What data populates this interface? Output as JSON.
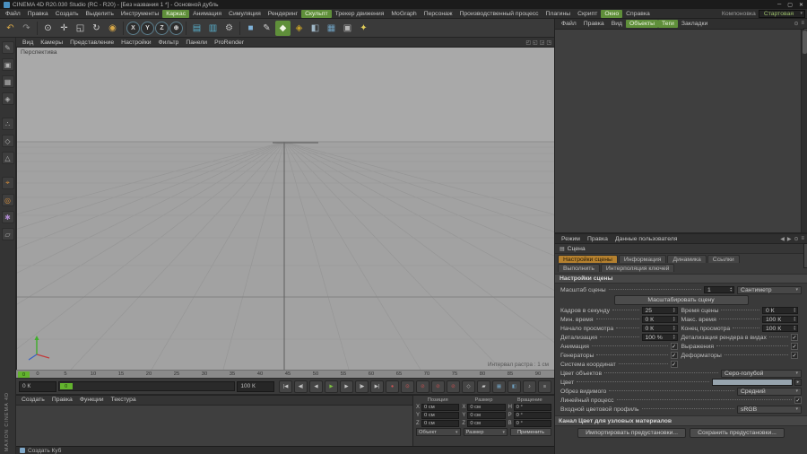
{
  "ui": {
    "dropdown_arrow": "▾",
    "check": "✓",
    "spin_up": "▲",
    "spin_down": "▼",
    "expand": "▸",
    "win_min": "─",
    "win_max": "▢",
    "win_close": "✕"
  },
  "colors": {
    "accent_green": "#5f8f3a",
    "active_tab_orange": "#b5812f",
    "viewport_gray": "#a6a6a6",
    "play_green": "#7dc142",
    "timeline_marker_green": "#63b32e",
    "object_color_swatch": "#97a4ae"
  },
  "titlebar": {
    "title": "CINEMA 4D R20.030 Studio (RC - R20) - [Без названия 1 *] - Основной дубль"
  },
  "menubar": {
    "items": [
      {
        "label": "Файл"
      },
      {
        "label": "Правка"
      },
      {
        "label": "Создать"
      },
      {
        "label": "Выделить"
      },
      {
        "label": "Инструменты"
      },
      {
        "label": "Каркас",
        "highlight": true
      },
      {
        "label": "Анимация"
      },
      {
        "label": "Симуляция"
      },
      {
        "label": "Рендеринг"
      },
      {
        "label": "Скульпт",
        "highlight": true
      },
      {
        "label": "Трекер движения"
      },
      {
        "label": "MoGraph"
      },
      {
        "label": "Персонаж"
      },
      {
        "label": "Производственный процесс"
      },
      {
        "label": "Плагины"
      },
      {
        "label": "Скрипт"
      },
      {
        "label": "Окно",
        "highlight": true
      },
      {
        "label": "Справка"
      }
    ],
    "layout_label": "Компоновка",
    "layout_value": "Стартовая"
  },
  "toolbar": {
    "icons": [
      {
        "name": "undo-icon",
        "glyph": "↶",
        "color": "#d8a848"
      },
      {
        "name": "redo-icon",
        "glyph": "↷",
        "color": "#8f8f8f"
      },
      {
        "sep": true
      },
      {
        "name": "live-selection-icon",
        "glyph": "⊙",
        "color": "#d8d8d8"
      },
      {
        "name": "move-icon",
        "glyph": "✛",
        "color": "#cfcfcf"
      },
      {
        "name": "scale-icon",
        "glyph": "◱",
        "color": "#cfcfcf"
      },
      {
        "name": "rotate-icon",
        "glyph": "↻",
        "color": "#cfcfcf"
      },
      {
        "name": "last-tool-icon",
        "glyph": "◉",
        "color": "#d8a848"
      },
      {
        "sep": true
      },
      {
        "name": "x-axis-lock-button",
        "glyph": "X",
        "circle": true,
        "color": "#d8d8d8"
      },
      {
        "name": "y-axis-lock-button",
        "glyph": "Y",
        "circle": true,
        "color": "#d8d8d8"
      },
      {
        "name": "z-axis-lock-button",
        "glyph": "Z",
        "circle": true,
        "color": "#d8d8d8"
      },
      {
        "name": "coordinate-system-button",
        "glyph": "⊕",
        "circle": true,
        "color": "#d8d8d8"
      },
      {
        "sep": true
      },
      {
        "name": "render-view-icon",
        "glyph": "▤",
        "color": "#58aecb"
      },
      {
        "name": "render-picture-viewer-icon",
        "glyph": "▥",
        "color": "#58aecb"
      },
      {
        "name": "render-settings-icon",
        "glyph": "⚙",
        "color": "#b8b8b8"
      },
      {
        "sep": true
      },
      {
        "name": "add-primitive-icon",
        "glyph": "■",
        "color": "#7fb2d9"
      },
      {
        "name": "add-spline-icon",
        "glyph": "✎",
        "color": "#cfcfcf"
      },
      {
        "name": "add-generator-icon",
        "glyph": "◆",
        "active": true,
        "color": "#eaf2da"
      },
      {
        "name": "add-deformer-icon",
        "glyph": "◈",
        "color": "#c9a227"
      },
      {
        "name": "environment-icon",
        "glyph": "◧",
        "color": "#9fb7c7"
      },
      {
        "name": "mograph-grid-icon",
        "glyph": "▦",
        "color": "#6fa0c0"
      },
      {
        "name": "camera-icon",
        "glyph": "▣",
        "color": "#b5b5b5"
      },
      {
        "name": "light-icon",
        "glyph": "✦",
        "color": "#e3cf5a"
      }
    ]
  },
  "side_toolbar": {
    "icons": [
      {
        "name": "make-editable-icon",
        "glyph": "✎",
        "color": "#b5b5b5"
      },
      {
        "name": "model-mode-icon",
        "glyph": "▣",
        "color": "#b5b5b5"
      },
      {
        "name": "texture-mode-icon",
        "glyph": "▦",
        "color": "#b5b5b5"
      },
      {
        "name": "workplane-mode-icon",
        "glyph": "◈",
        "color": "#b5b5b5"
      },
      {
        "gap": true
      },
      {
        "name": "points-mode-icon",
        "glyph": "∴",
        "color": "#b5b5b5"
      },
      {
        "name": "edges-mode-icon",
        "glyph": "◇",
        "color": "#b5b5b5"
      },
      {
        "name": "polygons-mode-icon",
        "glyph": "△",
        "color": "#b5b5b5"
      },
      {
        "gap": true
      },
      {
        "name": "enable-axis-icon",
        "glyph": "⌖",
        "color": "#d08a3a"
      },
      {
        "name": "axis-workplane-icon",
        "glyph": "◎",
        "color": "#d08a3a"
      },
      {
        "name": "snap-icon",
        "glyph": "✱",
        "color": "#b08ad0"
      },
      {
        "name": "lock-workplane-icon",
        "glyph": "▱",
        "color": "#b5b5b5"
      }
    ]
  },
  "viewport": {
    "menu": [
      "Вид",
      "Камеры",
      "Представление",
      "Настройки",
      "Фильтр",
      "Панели",
      "ProRender"
    ],
    "corner_icons": [
      {
        "name": "pan-view-icon",
        "glyph": "◰"
      },
      {
        "name": "zoom-view-icon",
        "glyph": "◱"
      },
      {
        "name": "rotate-view-icon",
        "glyph": "◲"
      },
      {
        "name": "toggle-view-icon",
        "glyph": "◳"
      }
    ],
    "label": "Перспектива",
    "raster": "Интервал растра : 1 см"
  },
  "timeline": {
    "ticks": [
      "0",
      "5",
      "10",
      "15",
      "20",
      "25",
      "30",
      "35",
      "40",
      "45",
      "50",
      "55",
      "60",
      "65",
      "70",
      "75",
      "80",
      "85",
      "90"
    ],
    "marker": "0"
  },
  "transport": {
    "start": "0 К",
    "end": "100 К",
    "slider_value": "0",
    "buttons": [
      {
        "name": "goto-start-button",
        "glyph": "|◀"
      },
      {
        "name": "prev-key-button",
        "glyph": "◀|"
      },
      {
        "name": "prev-frame-button",
        "glyph": "◀"
      },
      {
        "name": "play-button",
        "glyph": "▶",
        "color": "#7dc142"
      },
      {
        "name": "next-frame-button",
        "glyph": "▶"
      },
      {
        "name": "next-key-button",
        "glyph": "|▶"
      },
      {
        "name": "goto-end-button",
        "glyph": "▶|"
      },
      {
        "name": "record-button",
        "glyph": "●",
        "color": "#cc5555"
      },
      {
        "name": "autokey-button",
        "glyph": "⊙",
        "color": "#cc5555"
      },
      {
        "name": "record-position-button",
        "glyph": "⊘",
        "color": "#c05050"
      },
      {
        "name": "record-scale-button",
        "glyph": "⊘",
        "color": "#c05050"
      },
      {
        "name": "record-rotation-button",
        "glyph": "⊘",
        "color": "#c05050"
      },
      {
        "name": "record-parameter-button",
        "glyph": "◇"
      },
      {
        "name": "record-pla-button",
        "glyph": "▰"
      },
      {
        "name": "playback-options-button",
        "glyph": "▦",
        "color": "#6fa0c0"
      },
      {
        "name": "render-preview-button",
        "glyph": "◧",
        "color": "#6fa0c0"
      },
      {
        "name": "sound-button",
        "glyph": "♪"
      },
      {
        "name": "frame-options-button",
        "glyph": "≡"
      }
    ]
  },
  "material_manager": {
    "tabs": [
      "Создать",
      "Правка",
      "Функции",
      "Текстура"
    ],
    "brand": "MAXON CINEMA 4D"
  },
  "coord_manager": {
    "columns": [
      {
        "title": "Позиция",
        "axes": [
          {
            "label": "X",
            "value": "0 см"
          },
          {
            "label": "Y",
            "value": "0 см"
          },
          {
            "label": "Z",
            "value": "0 см"
          }
        ]
      },
      {
        "title": "Размер",
        "axes": [
          {
            "label": "X",
            "value": "0 см"
          },
          {
            "label": "Y",
            "value": "0 см"
          },
          {
            "label": "Z",
            "value": "0 см"
          }
        ]
      },
      {
        "title": "Вращение",
        "axes": [
          {
            "label": "H",
            "value": "0 °"
          },
          {
            "label": "P",
            "value": "0 °"
          },
          {
            "label": "B",
            "value": "0 °"
          }
        ]
      }
    ],
    "mode_dropdown": "Объект",
    "size_dropdown": "Размер",
    "apply_button": "Применить"
  },
  "statusbar": {
    "text": "Создать Куб"
  },
  "object_manager": {
    "menu": [
      {
        "label": "Файл"
      },
      {
        "label": "Правка"
      },
      {
        "label": "Вид"
      },
      {
        "label": "Объекты",
        "highlight": true
      },
      {
        "label": "Теги",
        "highlight": true
      },
      {
        "label": "Закладки"
      }
    ],
    "icons": [
      {
        "name": "search-icon",
        "glyph": "⊙"
      },
      {
        "name": "filter-icon",
        "glyph": "≡"
      }
    ]
  },
  "attributes": {
    "menu": [
      "Режим",
      "Правка",
      "Данные пользователя"
    ],
    "menu_icons": [
      {
        "name": "history-back-icon",
        "glyph": "◀"
      },
      {
        "name": "history-forward-icon",
        "glyph": "▶"
      },
      {
        "name": "lock-icon",
        "glyph": "⊙"
      },
      {
        "name": "options-icon",
        "glyph": "≡"
      }
    ],
    "object": "Сцена",
    "tabs": [
      {
        "label": "Настройки сцены",
        "active": true
      },
      {
        "label": "Информация"
      },
      {
        "label": "Динамика"
      },
      {
        "label": "Ссылки"
      }
    ],
    "tabs2": [
      {
        "label": "Выполнить"
      },
      {
        "label": "Интерполяция ключей"
      }
    ],
    "section": "Настройки сцены",
    "rows": [
      {
        "kind": "field-dd",
        "name": "project-scale",
        "label": "Масштаб сцены",
        "value": "1",
        "unit": "Сантиметр"
      },
      {
        "kind": "button",
        "name": "scale-project",
        "label": "Масштабировать сцену"
      },
      {
        "kind": "pair",
        "left": {
          "name": "fps",
          "label": "Кадров в секунду",
          "value": "25"
        },
        "right": {
          "name": "scene-time",
          "label": "Время сцены",
          "value": "0 К"
        }
      },
      {
        "kind": "pair",
        "left": {
          "name": "min-time",
          "label": "Мин. время",
          "value": "0 К"
        },
        "right": {
          "name": "max-time",
          "label": "Макс. время",
          "value": "100 К"
        }
      },
      {
        "kind": "pair",
        "left": {
          "name": "preview-start",
          "label": "Начало просмотра",
          "value": "0 К"
        },
        "right": {
          "name": "preview-end",
          "label": "Конец просмотра",
          "value": "100 К"
        }
      },
      {
        "kind": "pair",
        "left": {
          "name": "lod",
          "label": "Детализация",
          "value": "100 %"
        },
        "right": {
          "name": "render-lod",
          "label": "Детализация рендера в видах",
          "check": true
        }
      },
      {
        "kind": "pair",
        "left": {
          "name": "animation",
          "label": "Анимация",
          "check": true
        },
        "right": {
          "name": "expressions",
          "label": "Выражения",
          "check": true
        }
      },
      {
        "kind": "pair",
        "left": {
          "name": "generators",
          "label": "Генераторы",
          "check": true
        },
        "right": {
          "name": "deformers",
          "label": "Деформаторы",
          "check": true
        }
      },
      {
        "kind": "pair",
        "left": {
          "name": "coord-system",
          "label": "Система координат",
          "check": true
        },
        "right": null
      },
      {
        "kind": "dropdown",
        "name": "object-color",
        "label": "Цвет объектов",
        "value": "Серо-голубой",
        "wide": true
      },
      {
        "kind": "swatch",
        "name": "color",
        "label": "Цвет",
        "color": "#97a4ae"
      },
      {
        "kind": "dropdown",
        "name": "view-clipping",
        "label": "Обрез видимого",
        "value": "Средний"
      },
      {
        "kind": "check",
        "name": "linear-workflow",
        "label": "Линейный процесс",
        "check": true
      },
      {
        "kind": "dropdown",
        "name": "input-color-profile",
        "label": "Входной цветовой профиль",
        "value": "sRGB"
      },
      {
        "kind": "section",
        "name": "node-color-channel",
        "label": "Канал Цвет для узловых материалов"
      },
      {
        "kind": "buttons2",
        "name": "presets",
        "a": "Импортировать предустановки...",
        "b": "Сохранить предустановки..."
      }
    ]
  }
}
